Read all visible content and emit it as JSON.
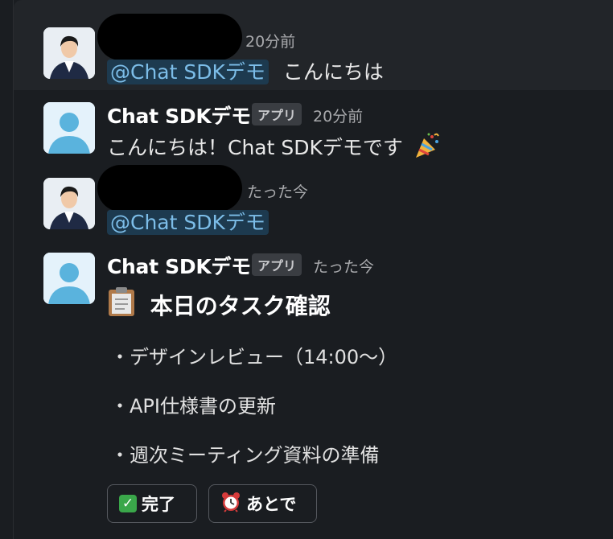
{
  "messages": [
    {
      "time": "20分前",
      "mention": "@Chat SDKデモ",
      "text": "こんにちは"
    },
    {
      "name": "Chat SDKデモ",
      "badge": "アプリ",
      "time": "20分前",
      "text": "こんにちは！Chat SDKデモです"
    },
    {
      "time": "たった今",
      "mention": "@Chat SDKデモ"
    },
    {
      "name": "Chat SDKデモ",
      "badge": "アプリ",
      "time": "たった今",
      "task_title": "本日のタスク確認",
      "tasks": [
        "・デザインレビュー（14:00〜）",
        "・API仕様書の更新",
        "・週次ミーティング資料の準備"
      ],
      "buttons": {
        "done": "完了",
        "later": "あとで"
      }
    }
  ],
  "icons": [
    "clipboard-icon",
    "party-popper-icon",
    "check-mark-icon",
    "alarm-clock-icon"
  ],
  "colors": {
    "background": "#1a1d21",
    "mention_bg": "#1d3a4f",
    "mention_text": "#7cbde8"
  }
}
